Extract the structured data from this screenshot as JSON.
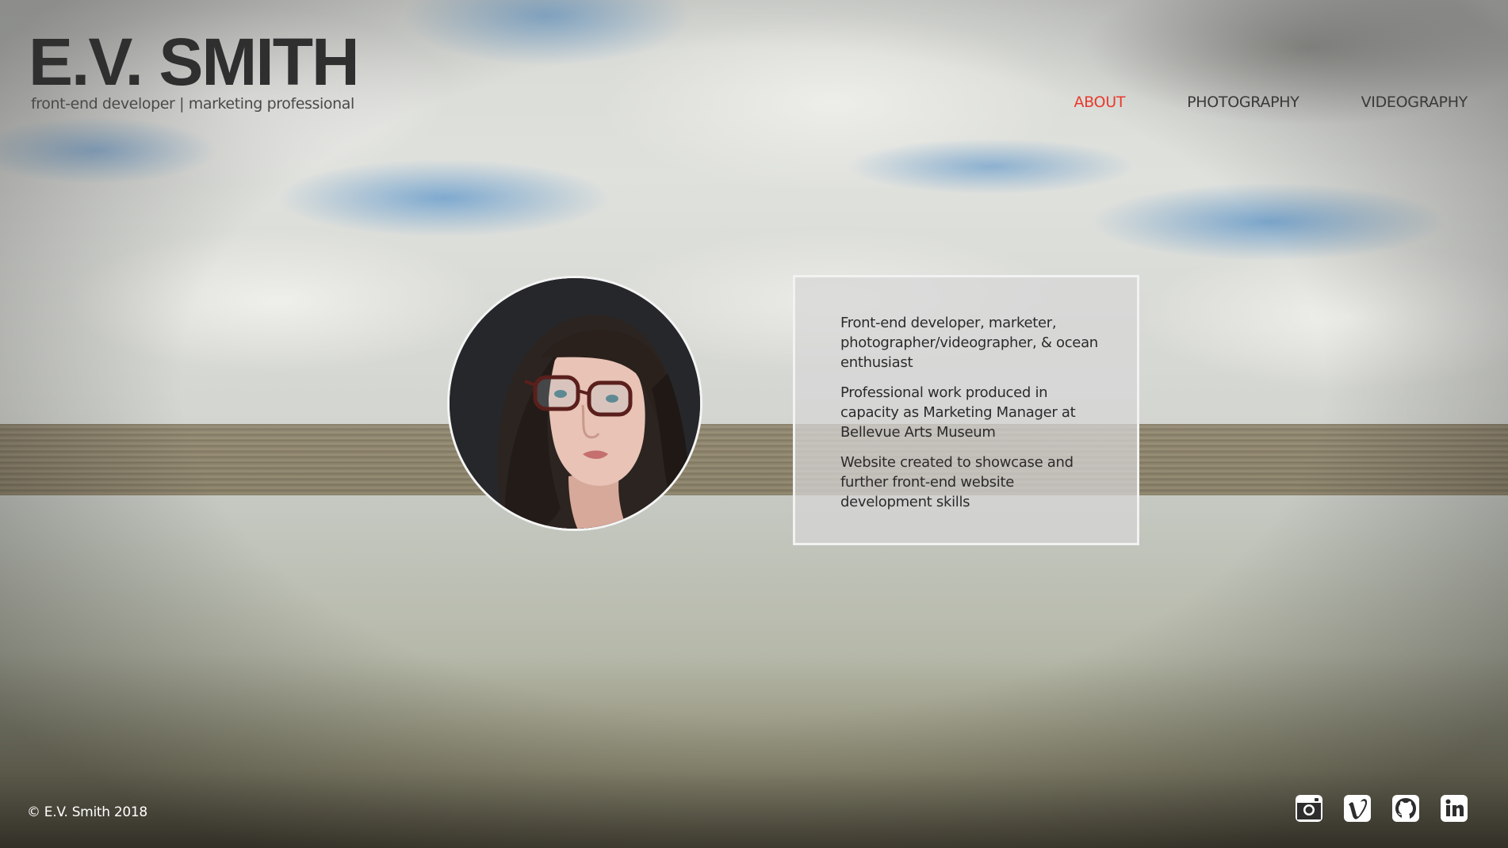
{
  "header": {
    "title": "E.V. SMITH",
    "subtitle": "front-end developer | marketing professional"
  },
  "nav": {
    "items": [
      {
        "label": "ABOUT",
        "active": true
      },
      {
        "label": "PHOTOGRAPHY",
        "active": false
      },
      {
        "label": "VIDEOGRAPHY",
        "active": false
      }
    ]
  },
  "about": {
    "paragraphs": [
      "Front-end developer, marketer, photographer/videographer, & ocean enthusiast",
      "Professional work produced in capacity as Marketing Manager at Bellevue Arts Museum",
      "Website created to showcase and further front-end website development skills"
    ]
  },
  "footer": {
    "copyright": "© E.V. Smith 2018",
    "social": [
      {
        "icon": "instagram-icon"
      },
      {
        "icon": "vimeo-icon"
      },
      {
        "icon": "github-icon"
      },
      {
        "icon": "linkedin-icon"
      }
    ]
  },
  "colors": {
    "accent": "#e8392b",
    "title": "#2f2f2f",
    "card_bg": "rgba(215,215,215,0.72)"
  }
}
